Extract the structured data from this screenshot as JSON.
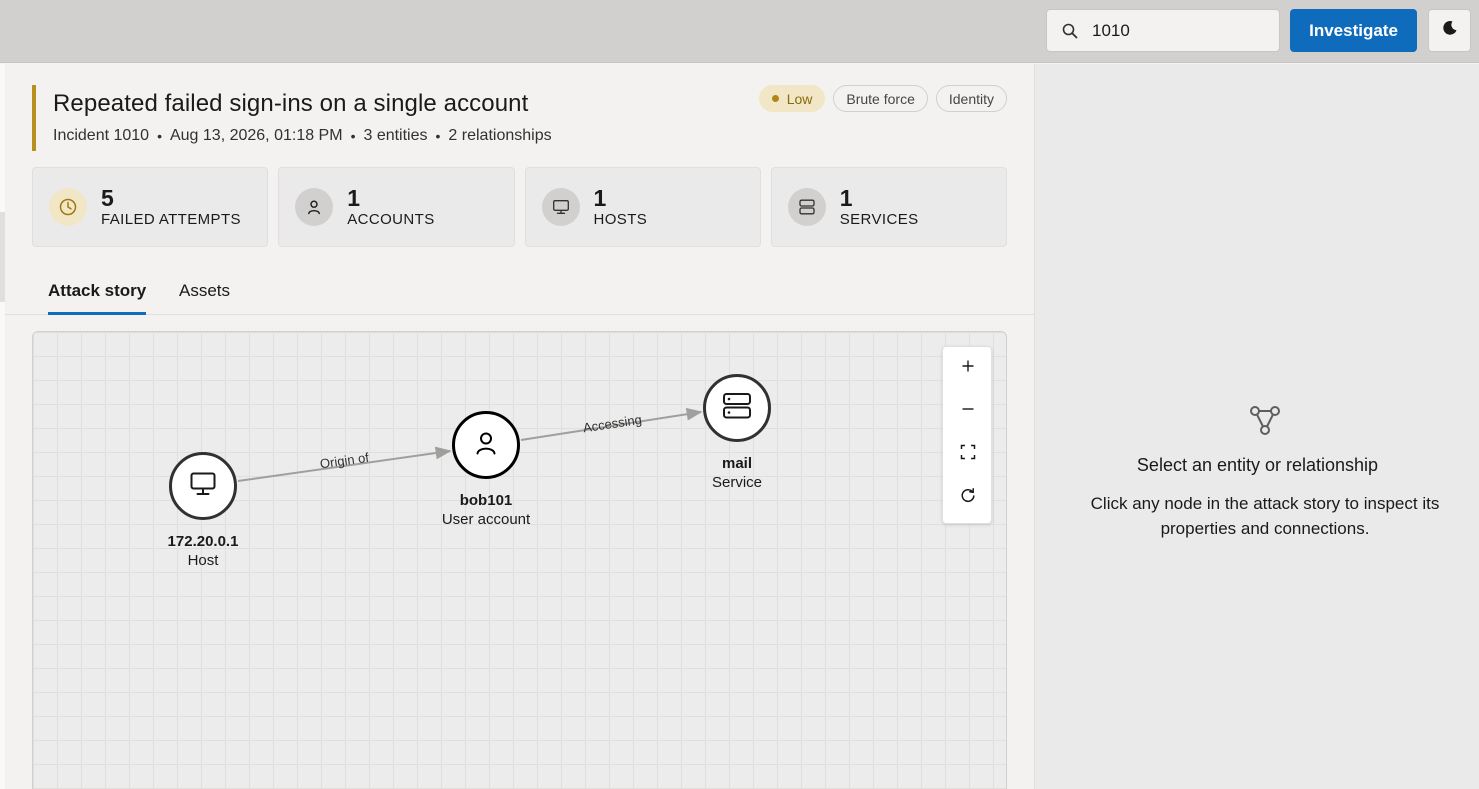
{
  "topbar": {
    "search_value": "1010",
    "investigate_label": "Investigate"
  },
  "incident": {
    "title": "Repeated failed sign-ins on a single account",
    "meta": [
      "Incident 1010",
      "Aug 13, 2026, 01:18 PM",
      "3 entities",
      "2 relationships"
    ],
    "tags": [
      "Low",
      "Brute force",
      "Identity"
    ],
    "severity_color": "#b08614"
  },
  "stats": [
    {
      "value": "5",
      "label": "FAILED ATTEMPTS",
      "icon": "clock-icon"
    },
    {
      "value": "1",
      "label": "ACCOUNTS",
      "icon": "user-icon"
    },
    {
      "value": "1",
      "label": "HOSTS",
      "icon": "monitor-icon"
    },
    {
      "value": "1",
      "label": "SERVICES",
      "icon": "server-icon"
    }
  ],
  "tabs": [
    "Attack story",
    "Assets"
  ],
  "graph": {
    "nodes": [
      {
        "name": "172.20.0.1",
        "type": "Host",
        "icon": "monitor-icon"
      },
      {
        "name": "bob101",
        "type": "User account",
        "icon": "user-icon"
      },
      {
        "name": "mail",
        "type": "Service",
        "icon": "server-icon"
      }
    ],
    "edges": [
      {
        "label": "Origin of",
        "from": "172.20.0.1",
        "to": "bob101"
      },
      {
        "label": "Accessing",
        "from": "bob101",
        "to": "mail"
      }
    ]
  },
  "side": {
    "title": "Select an entity or relationship",
    "description": "Click any node in the attack story to inspect its properties and connections."
  },
  "colors": {
    "accent": "#0f6cbd",
    "severity_low_bg": "#f1e6c6"
  }
}
